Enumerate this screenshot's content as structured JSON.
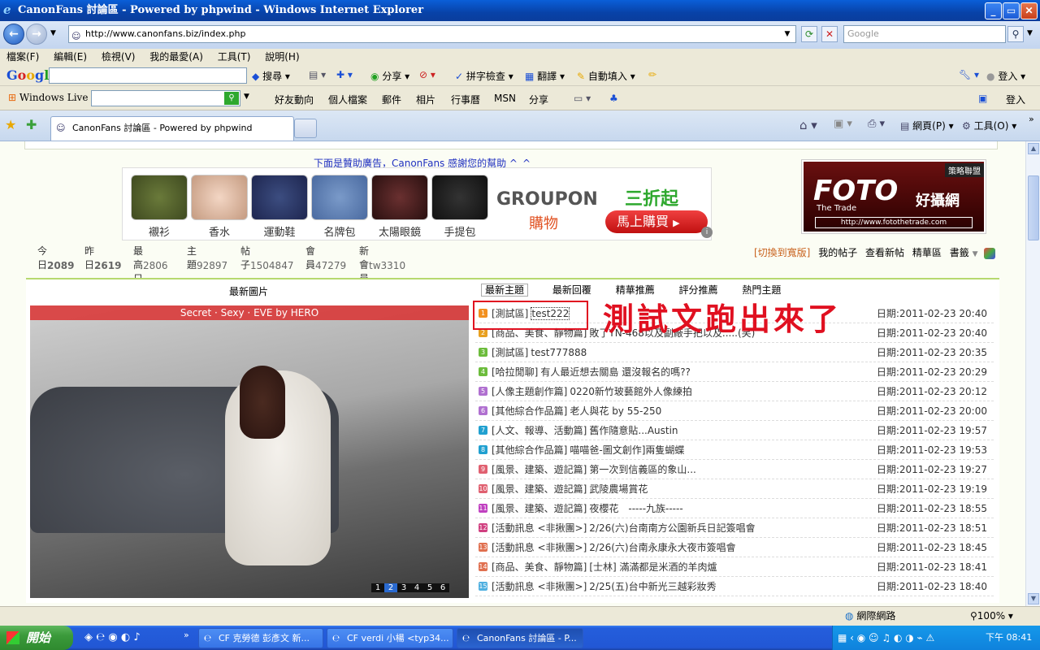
{
  "window": {
    "title": "CanonFans 討論區 - Powered by phpwind - Windows Internet Explorer"
  },
  "address": {
    "url": "http://www.canonfans.biz/index.php",
    "search_placeholder": "Google"
  },
  "menu": [
    "檔案(F)",
    "編輯(E)",
    "檢視(V)",
    "我的最愛(A)",
    "工具(T)",
    "說明(H)"
  ],
  "google_toolbar": {
    "logo": "Google",
    "items": [
      "搜尋",
      "分享",
      "拼字檢查",
      "翻譯",
      "自動填入"
    ],
    "login": "登入"
  },
  "wl_toolbar": {
    "label": "Windows Live",
    "items": [
      "好友動向",
      "個人檔案",
      "郵件",
      "相片",
      "行事曆",
      "MSN",
      "分享"
    ],
    "login": "登入"
  },
  "tabs": {
    "active": "CanonFans 討論區 - Powered by phpwind",
    "right_items": [
      "網頁(P)",
      "工具(O)"
    ]
  },
  "page": {
    "sponsor_text": "下面是贊助廣告，CanonFans 感謝您的幫助 ^_^",
    "ad_items": [
      "襯衫",
      "香水",
      "運動鞋",
      "名牌包",
      "太陽眼鏡",
      "手提包"
    ],
    "groupon_brand": "GROUPON",
    "groupon_sub": "購物",
    "groupon_deal": "三折起",
    "groupon_button": "馬上購買",
    "foto_tag": "策略聯盟",
    "foto_brand": "FOTO",
    "foto_sub": "The Trade",
    "foto_cn": "好攝網",
    "foto_url": "http://www.fotothetrade.com",
    "stats": [
      {
        "label": "今日",
        "value": "2089"
      },
      {
        "label": "昨日",
        "value": "2619"
      },
      {
        "label": "最高日",
        "value": "2806"
      },
      {
        "label": "主題",
        "value": "92897"
      },
      {
        "label": "帖子",
        "value": "1504847"
      },
      {
        "label": "會員",
        "value": "47279"
      },
      {
        "label": "新會員",
        "value": "tw3310"
      }
    ],
    "top_links": {
      "switch": "[切換到寬版]",
      "my_posts": "我的帖子",
      "new_posts": "查看新帖",
      "digest": "精華區",
      "bookmark": "書籤"
    },
    "latest_pic_title": "最新圖片",
    "pic_caption": "Secret · Sexy · EVE by HERO",
    "pic_pager": [
      "1",
      "2",
      "3",
      "4",
      "5",
      "6"
    ],
    "list_tabs": [
      "最新主題",
      "最新回覆",
      "精華推薦",
      "評分推薦",
      "熱門主題"
    ],
    "annotation": "測試文跑出來了",
    "posts": [
      {
        "num": "1",
        "cat": "[測試區]",
        "title": "test222",
        "date": "日期:2011-02-23 20:40"
      },
      {
        "num": "2",
        "cat": "[商品、美食、靜物篇]",
        "title": "敗了YN-468以及副廠手把以及.....(笑)",
        "date": "日期:2011-02-23 20:40"
      },
      {
        "num": "3",
        "cat": "[測試區]",
        "title": "test777888",
        "date": "日期:2011-02-23 20:35"
      },
      {
        "num": "4",
        "cat": "[哈拉閒聊]",
        "title": "有人最近想去關島 還沒報名的嗎??",
        "date": "日期:2011-02-23 20:29"
      },
      {
        "num": "5",
        "cat": "[人像主題創作篇]",
        "title": "0220新竹玻藝館外人像練拍",
        "date": "日期:2011-02-23 20:12"
      },
      {
        "num": "6",
        "cat": "[其他綜合作品篇]",
        "title": "老人與花 by 55-250",
        "date": "日期:2011-02-23 20:00"
      },
      {
        "num": "7",
        "cat": "[人文、報導、活動篇]",
        "title": "舊作隨意貼...Austin",
        "date": "日期:2011-02-23 19:57"
      },
      {
        "num": "8",
        "cat": "[其他綜合作品篇]",
        "title": "喵喵爸-圖文創作]兩隻蝴蝶",
        "date": "日期:2011-02-23 19:53"
      },
      {
        "num": "9",
        "cat": "[風景、建築、遊記篇]",
        "title": "第一次到信義區的象山...",
        "date": "日期:2011-02-23 19:27"
      },
      {
        "num": "10",
        "cat": "[風景、建築、遊記篇]",
        "title": "武陵農場賞花",
        "date": "日期:2011-02-23 19:19"
      },
      {
        "num": "11",
        "cat": "[風景、建築、遊記篇]",
        "title": "夜櫻花　-----九族-----",
        "date": "日期:2011-02-23 18:55"
      },
      {
        "num": "12",
        "cat": "[活動訊息 <非揪團>]",
        "title": "2/26(六)台南南方公園新兵日記簽唱會",
        "date": "日期:2011-02-23 18:51"
      },
      {
        "num": "13",
        "cat": "[活動訊息 <非揪團>]",
        "title": "2/26(六)台南永康永大夜市簽唱會",
        "date": "日期:2011-02-23 18:45"
      },
      {
        "num": "14",
        "cat": "[商品、美食、靜物篇]",
        "title": "[士林] 滿滿都是米酒的羊肉爐",
        "date": "日期:2011-02-23 18:41"
      },
      {
        "num": "15",
        "cat": "[活動訊息 <非揪團>]",
        "title": "2/25(五)台中新光三越彩妝秀",
        "date": "日期:2011-02-23 18:40"
      }
    ]
  },
  "status": {
    "zone": "網際網路",
    "zoom": "100%"
  },
  "taskbar": {
    "start": "開始",
    "tasks": [
      "CF 克勞德 彭彥文 新...",
      "CF verdi 小楊 <typ34...",
      "CanonFans 討論區 - P..."
    ],
    "clock": "下午 08:41"
  },
  "colors": {
    "accent_red": "#e01020",
    "ie_blue": "#0842a8"
  }
}
